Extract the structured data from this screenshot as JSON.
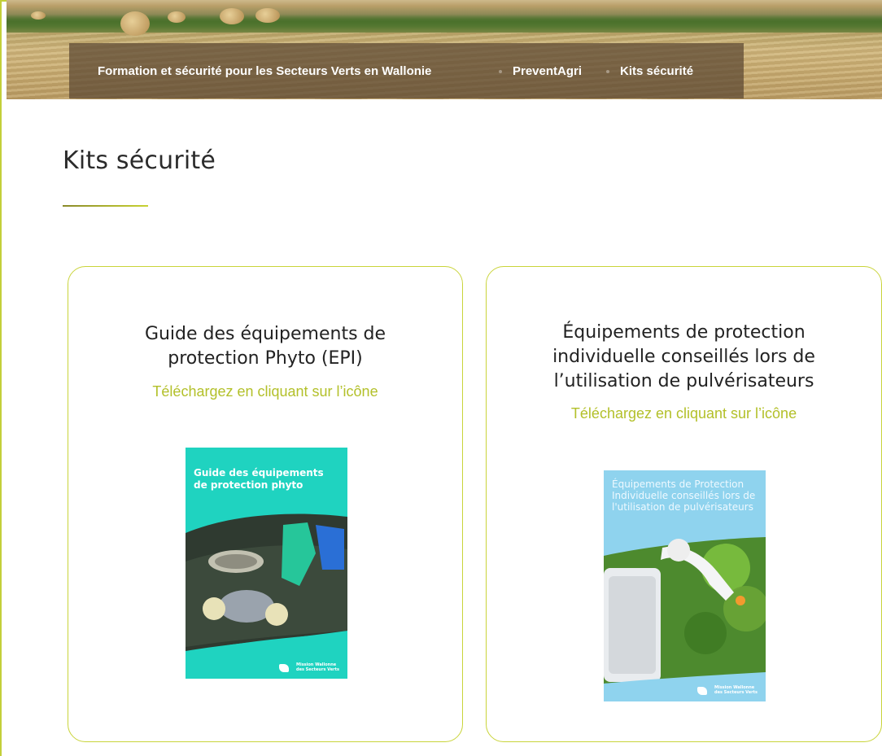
{
  "header": {
    "nav": [
      {
        "label": "Formation et sécurité pour les Secteurs Verts en Wallonie"
      },
      {
        "label": "PreventAgri"
      },
      {
        "label": "Kits sécurité"
      }
    ]
  },
  "main": {
    "title": "Kits sécurité",
    "cards": [
      {
        "title_line1": "Guide des équipements de",
        "title_line2": "protection Phyto (EPI)",
        "cta": "Téléchargez en cliquant sur l’icône",
        "cover": {
          "title": "Guide des équipements de protection phyto",
          "footer_line1": "Mission Wallonne",
          "footer_line2": "des Secteurs Verts",
          "color": "#1fd3c0"
        }
      },
      {
        "title_line1": "Équipements de protection",
        "title_line2": "individuelle conseillés lors de",
        "title_line3": "l’utilisation de pulvérisateurs",
        "cta": "Téléchargez en cliquant sur l’icône",
        "cover": {
          "title": "Équipements de Protection Individuelle conseillés lors de l'utilisation de pulvérisateurs",
          "footer_line1": "Mission Wallonne",
          "footer_line2": "des Secteurs Verts",
          "color": "#8fd3ee"
        }
      }
    ]
  },
  "colors": {
    "accent": "#c3cf3a",
    "cta": "#b3c02a",
    "nav_bg": "#5a4632"
  }
}
